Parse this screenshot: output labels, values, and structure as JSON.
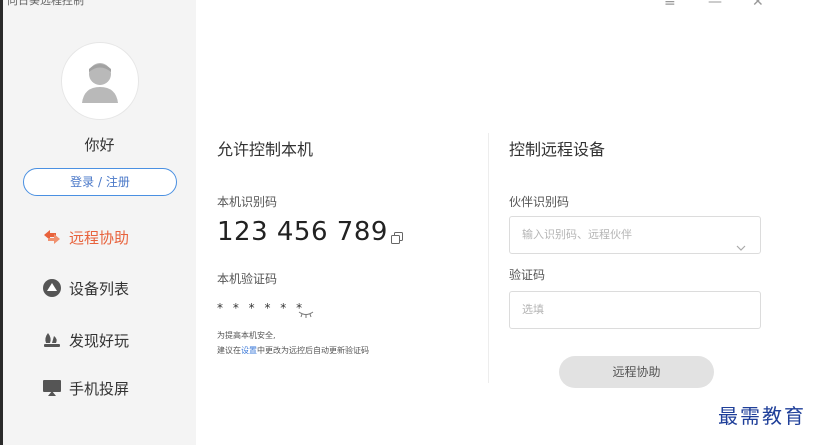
{
  "app": {
    "title": "向日葵远程控制"
  },
  "window_controls": {
    "menu": "≡",
    "minimize": "—",
    "close": "✕"
  },
  "sidebar": {
    "greeting": "你好",
    "login_label": "登录 / 注册",
    "items": [
      {
        "label": "远程协助",
        "icon": "remote-assist-icon",
        "active": true
      },
      {
        "label": "设备列表",
        "icon": "device-list-icon",
        "active": false
      },
      {
        "label": "发现好玩",
        "icon": "discover-icon",
        "active": false
      },
      {
        "label": "手机投屏",
        "icon": "screen-cast-icon",
        "active": false
      }
    ]
  },
  "local": {
    "title": "允许控制本机",
    "id_label": "本机识别码",
    "id_value": "123 456 789",
    "code_label": "本机验证码",
    "code_value": "* * * * * *",
    "note_line1": "为提高本机安全,",
    "note_prefix": "建议在",
    "note_link": "设置",
    "note_suffix": "中更改为远控后自动更新验证码"
  },
  "remote": {
    "title": "控制远程设备",
    "partner_label": "伙伴识别码",
    "partner_placeholder": "输入识别码、远程伙伴",
    "code_label": "验证码",
    "code_placeholder": "选填",
    "connect_label": "远程协助"
  },
  "colors": {
    "accent": "#e8623c",
    "link": "#3a78d8",
    "button_border": "#4a90e2"
  },
  "watermark": "最需教育"
}
